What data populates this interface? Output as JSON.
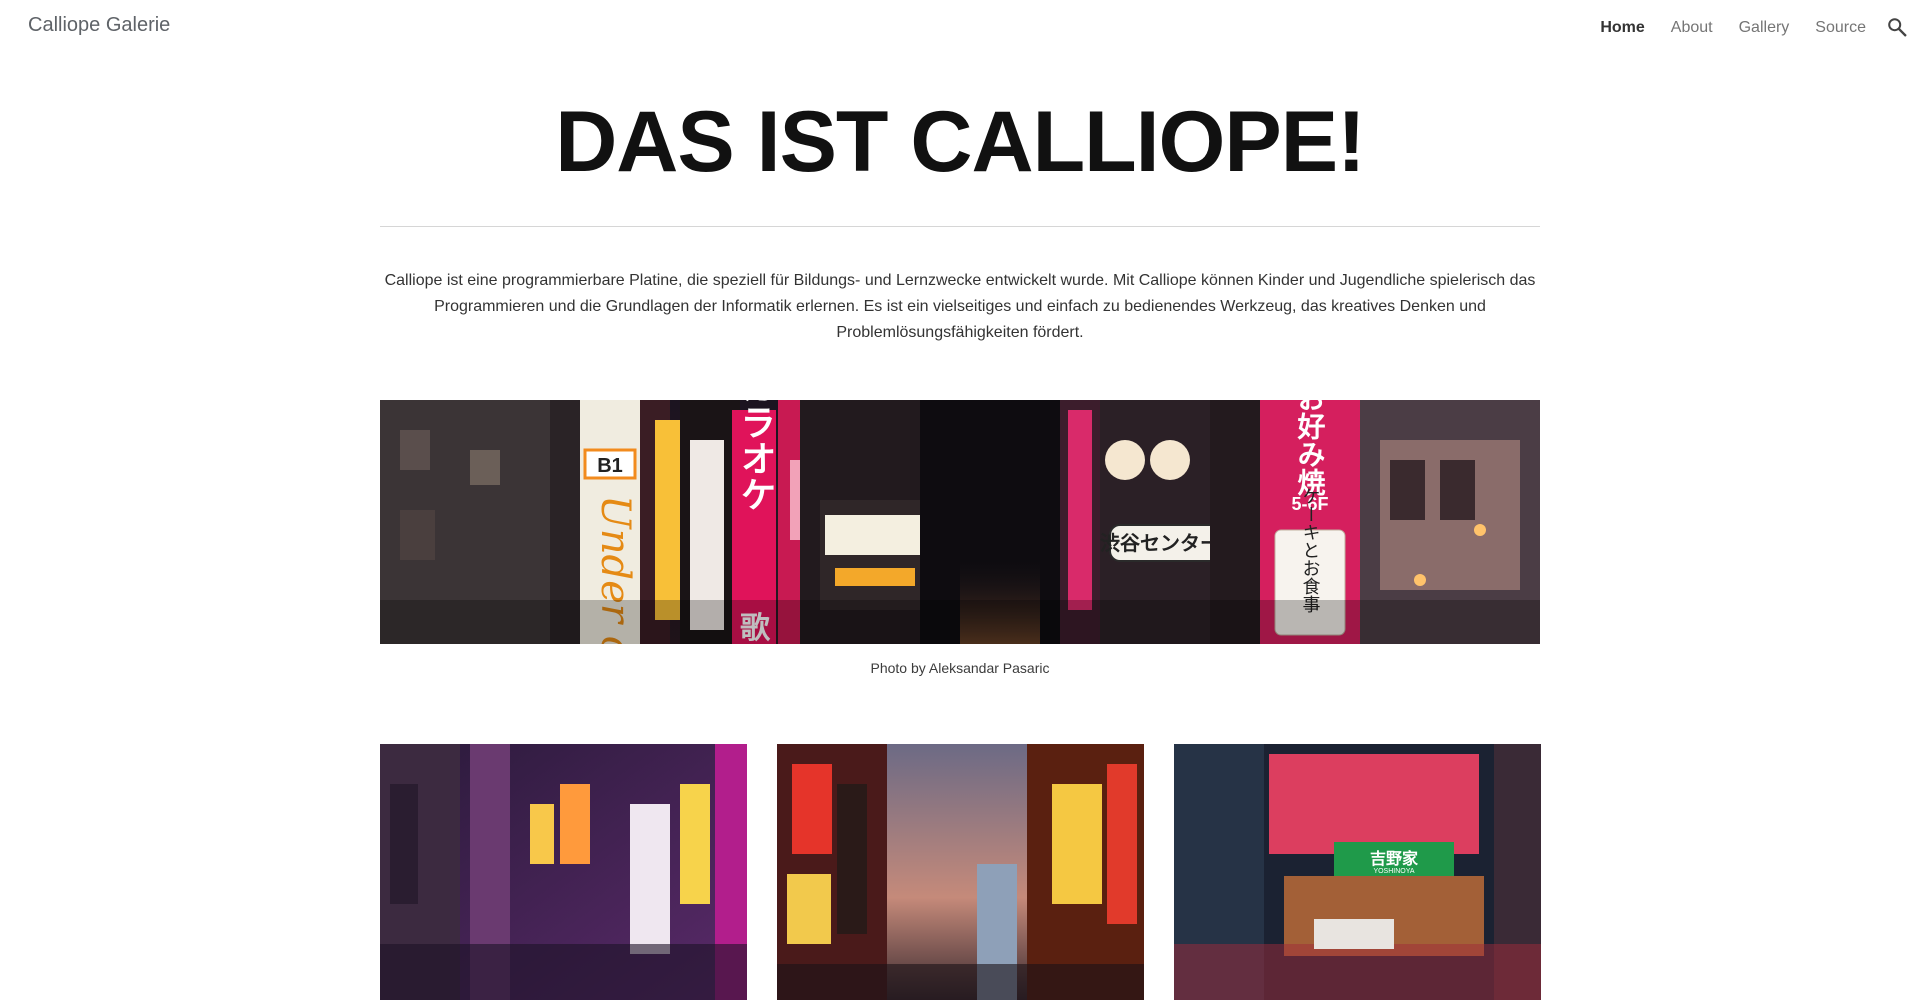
{
  "header": {
    "site_title": "Calliope Galerie",
    "nav": [
      {
        "label": "Home",
        "active": true
      },
      {
        "label": "About",
        "active": false
      },
      {
        "label": "Gallery",
        "active": false
      },
      {
        "label": "Source",
        "active": false
      }
    ],
    "search_icon": "search-icon"
  },
  "main": {
    "title": "DAS IST CALLIOPE!",
    "intro": "Calliope ist eine programmierbare Platine, die speziell für Bildungs- und Lernzwecke entwickelt wurde. Mit Calliope können Kinder und Jugendliche spielerisch das Programmieren und die Grundlagen der Informatik erlernen. Es ist ein vielseitiges und einfach zu bedienendes Werkzeug, das kreatives Denken und Problemlösungsfähigkeiten fördert.",
    "banner_caption": "Photo by Aleksandar Pasaric",
    "banner_signs": {
      "b1": "B1",
      "under": "Under cra",
      "karaoke": "カラオケ",
      "uta": "歌",
      "center_gai": "渋谷センター街",
      "okonomi": "お好み焼",
      "size": "5-6F",
      "cake": "ケーキとお食事"
    },
    "thumb_signs": {
      "yoshinoya": "吉野家",
      "yoshinoya_en": "YOSHINOYA"
    }
  },
  "colors": {
    "nav_active": "#333333",
    "nav_inactive": "#757575",
    "neon_pink": "#e8156b",
    "neon_orange": "#f5a623"
  }
}
